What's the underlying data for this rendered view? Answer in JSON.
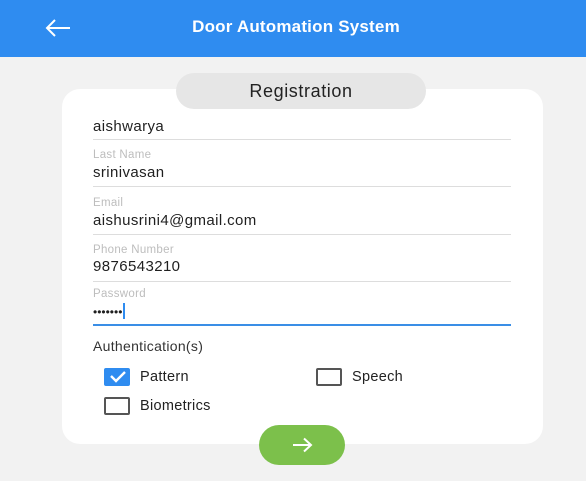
{
  "appbar": {
    "title": "Door Automation System",
    "back_icon": "arrow-left-icon"
  },
  "form": {
    "heading": "Registration",
    "fields": [
      {
        "label": "",
        "value": "aishwarya"
      },
      {
        "label": "Last Name",
        "value": "srinivasan"
      },
      {
        "label": "Email",
        "value": "aishusrini4@gmail.com"
      },
      {
        "label": "Phone Number",
        "value": "9876543210"
      },
      {
        "label": "Password",
        "value": "•••••••"
      }
    ],
    "auth_heading": "Authentication(s)",
    "options": [
      {
        "label": "Pattern",
        "checked": true
      },
      {
        "label": "Speech",
        "checked": false
      },
      {
        "label": "Biometrics",
        "checked": false
      }
    ],
    "next_icon": "arrow-right-icon"
  },
  "colors": {
    "appbar": "#2f8cf0",
    "accent": "#2f8cf0",
    "next_button": "#7cc04b",
    "background": "#f2f2f2"
  }
}
